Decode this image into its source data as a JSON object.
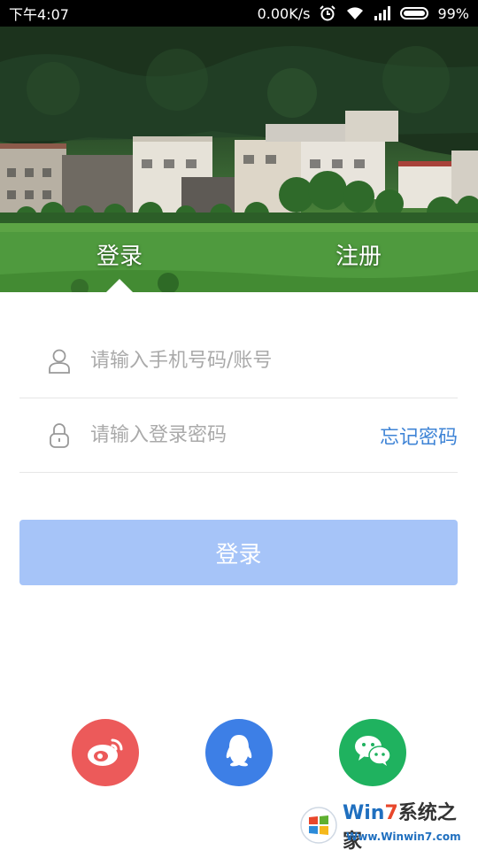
{
  "status_bar": {
    "time": "下午4:07",
    "network_speed": "0.00K/s",
    "battery_percent": "99%",
    "battery_level": 0.99,
    "icons": [
      "alarm-icon",
      "wifi-icon",
      "signal-icon",
      "battery-icon"
    ]
  },
  "header": {
    "tabs": [
      {
        "label": "登录",
        "selected": true
      },
      {
        "label": "注册",
        "selected": false
      }
    ]
  },
  "form": {
    "phone_placeholder": "请输入手机号码/账号",
    "phone_value": "",
    "password_placeholder": "请输入登录密码",
    "password_value": "",
    "forgot_label": "忘记密码",
    "login_label": "登录"
  },
  "social_login": [
    {
      "name": "weibo",
      "icon": "weibo-icon",
      "color": "#ec5a5a"
    },
    {
      "name": "qq",
      "icon": "qq-icon",
      "color": "#3d7fe6"
    },
    {
      "name": "wechat",
      "icon": "wechat-icon",
      "color": "#1fb25f"
    }
  ],
  "colors": {
    "accent": "#3f84d6",
    "button_disabled": "#a6c4f8"
  },
  "watermark": {
    "text_win": "Win",
    "text_7": "7",
    "text_cn": "系统之家",
    "url": "Www.Winwin7.com"
  }
}
